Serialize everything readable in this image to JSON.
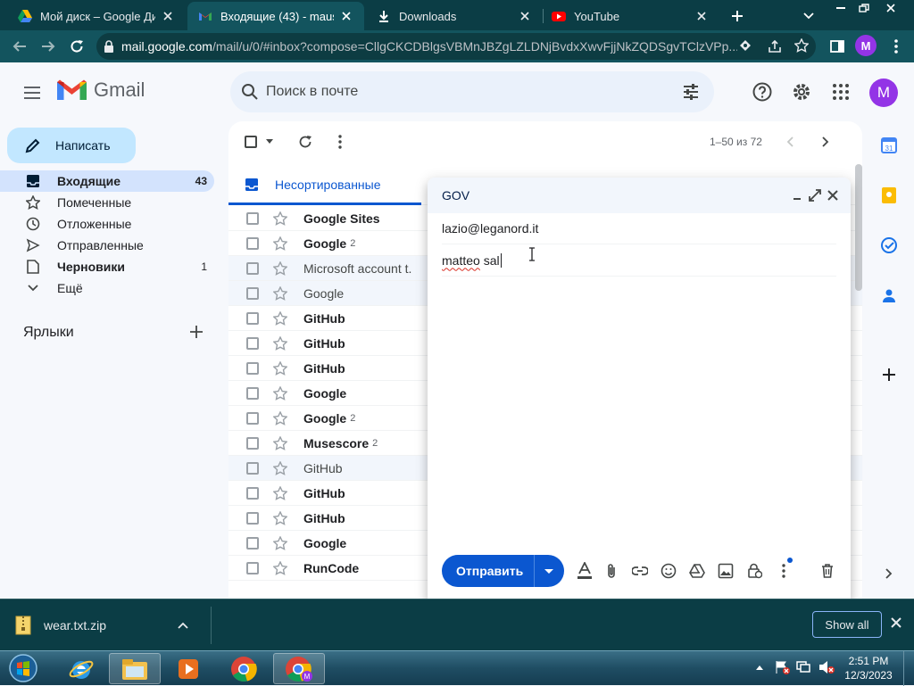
{
  "browser": {
    "tabs": [
      {
        "title": "Мой диск – Google Диск",
        "icon": "google-drive-icon",
        "active": false
      },
      {
        "title": "Входящие (43) - mausen",
        "icon": "gmail-icon",
        "active": true
      },
      {
        "title": "Downloads",
        "icon": "download-icon",
        "active": false
      },
      {
        "title": "YouTube",
        "icon": "youtube-icon",
        "active": false
      }
    ],
    "url_host": "mail.google.com",
    "url_rest": "/mail/u/0/#inbox?compose=CllgCKCDBlgsVBMnJBZgLZLDNjBvdxXwvFjjNkZQDSgvTClzVPp...",
    "profile_initial": "M"
  },
  "gmail": {
    "logo_text": "Gmail",
    "search_placeholder": "Поиск в почте",
    "avatar_initial": "M",
    "compose_label": "Написать",
    "nav": [
      {
        "label": "Входящие",
        "count": "43",
        "icon": "inbox-icon",
        "active": true,
        "bold": true
      },
      {
        "label": "Помеченные",
        "count": "",
        "icon": "star-outline-icon",
        "active": false,
        "bold": false
      },
      {
        "label": "Отложенные",
        "count": "",
        "icon": "clock-icon",
        "active": false,
        "bold": false
      },
      {
        "label": "Отправленные",
        "count": "",
        "icon": "send-icon",
        "active": false,
        "bold": false
      },
      {
        "label": "Черновики",
        "count": "1",
        "icon": "draft-icon",
        "active": false,
        "bold": true
      },
      {
        "label": "Ещё",
        "count": "",
        "icon": "chevron-down-icon",
        "active": false,
        "bold": false
      }
    ],
    "labels_heading": "Ярлыки",
    "page_info": "1–50 из 72",
    "tab_primary": "Несортированные",
    "emails": [
      {
        "sender": "Google Sites",
        "count": "",
        "read": false
      },
      {
        "sender": "Google",
        "count": "2",
        "read": false
      },
      {
        "sender": "Microsoft account t.",
        "count": "",
        "read": true
      },
      {
        "sender": "Google",
        "count": "",
        "read": true
      },
      {
        "sender": "GitHub",
        "count": "",
        "read": false
      },
      {
        "sender": "GitHub",
        "count": "",
        "read": false
      },
      {
        "sender": "GitHub",
        "count": "",
        "read": false
      },
      {
        "sender": "Google",
        "count": "",
        "read": false
      },
      {
        "sender": "Google",
        "count": "2",
        "read": false
      },
      {
        "sender": "Musescore",
        "count": "2",
        "read": false
      },
      {
        "sender": "GitHub",
        "count": "",
        "read": true
      },
      {
        "sender": "GitHub",
        "count": "",
        "read": false
      },
      {
        "sender": "GitHub",
        "count": "",
        "read": false
      },
      {
        "sender": "Google",
        "count": "",
        "read": false
      },
      {
        "sender": "RunCode",
        "count": "",
        "read": false
      }
    ],
    "compose": {
      "title": "GOV",
      "to": "lazio@leganord.it",
      "subject_part1": "matteo",
      "subject_part2": " sal",
      "send_label": "Отправить"
    }
  },
  "downloads": {
    "file_name": "wear.txt.zip",
    "show_all_label": "Show all"
  },
  "taskbar": {
    "time": "2:51 PM",
    "date": "12/3/2023"
  }
}
